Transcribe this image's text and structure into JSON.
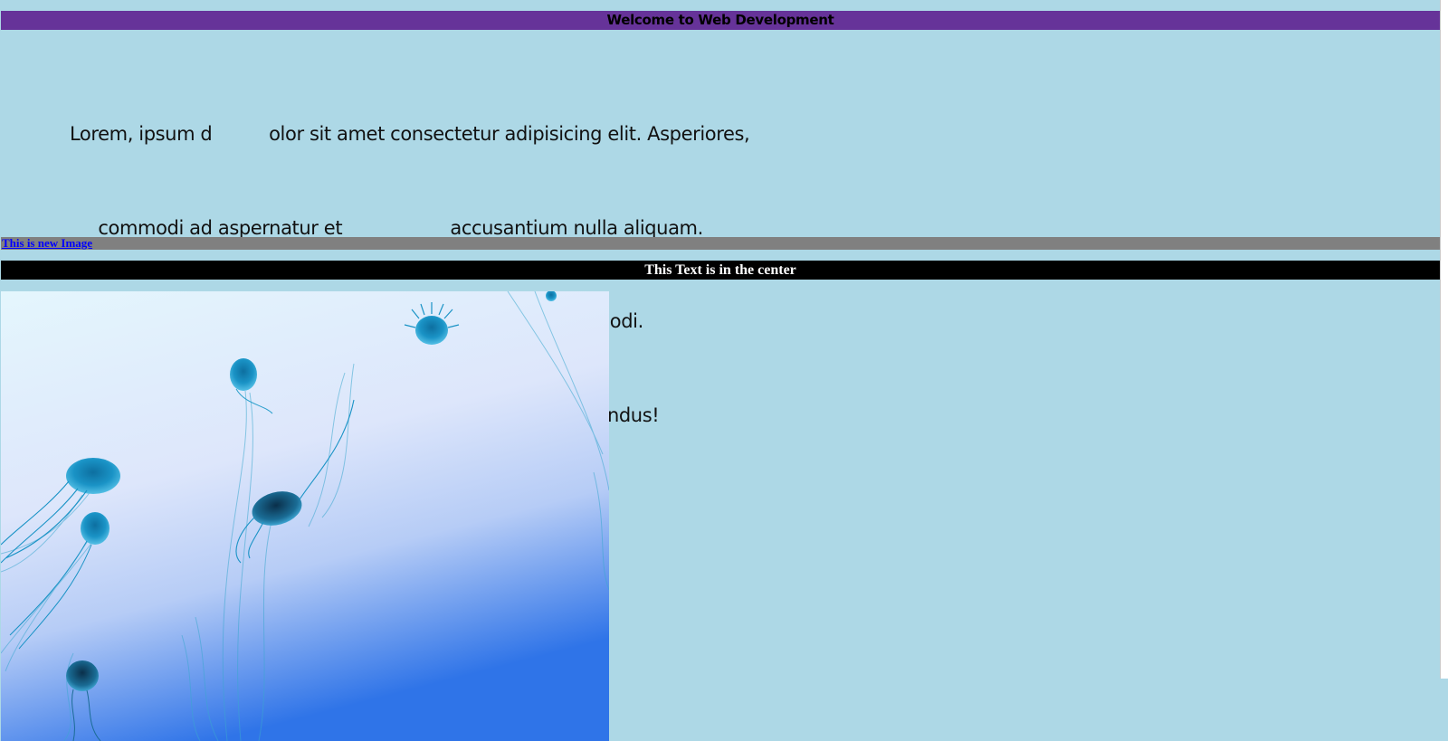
{
  "header": {
    "title": "Welcome to Web Development",
    "background": "#663399"
  },
  "paragraph": {
    "lines": [
      "Lorem, ipsum d          olor sit amet consectetur adipisicing elit. Asperiores,",
      "     commodi ad aspernatur et                   accusantium nulla aliquam.",
      "Voluptatibus ea ex                  consectetur ducimus unde modi.",
      "Impedit recusandae deleniti delectus quisquam, ex repellendus!"
    ]
  },
  "image_caption": {
    "link_text": "This is new Image",
    "bar_color": "#808080"
  },
  "center_banner": {
    "text": "This Text is in the center",
    "background": "#000000"
  },
  "image": {
    "subject": "jellyfish",
    "icon": "jellyfish-photo"
  },
  "page": {
    "background": "#add8e6"
  }
}
